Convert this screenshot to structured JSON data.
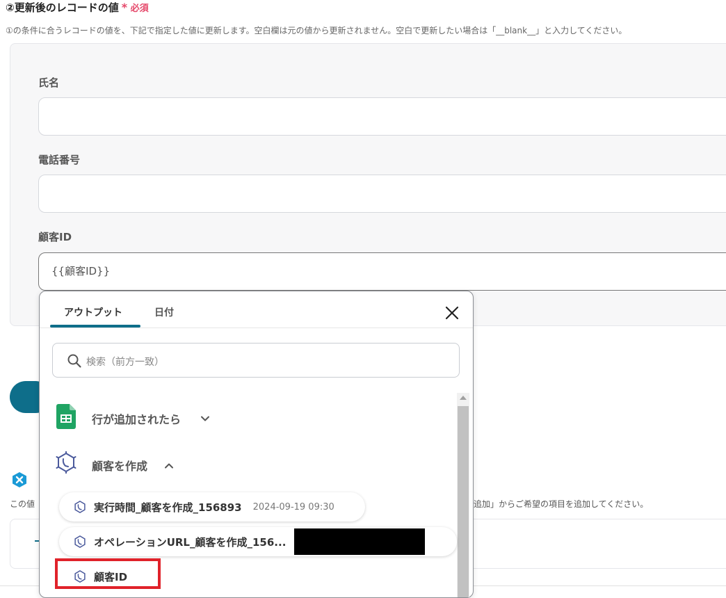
{
  "section": {
    "title": "②更新後のレコードの値",
    "required_mark": "*",
    "required_label": "必須",
    "description": "①の条件に合うレコードの値を、下記で指定した値に更新します。空白欄は元の値から更新されません。空白で更新したい場合は「__blank__」と入力してください。"
  },
  "fields": [
    {
      "label": "氏名",
      "value": ""
    },
    {
      "label": "電話番号",
      "value": ""
    },
    {
      "label": "顧客ID",
      "value": "{{顧客ID}}"
    }
  ],
  "background": {
    "desc_left": "この値",
    "desc_right": "追加」からご希望の項目を追加してください。"
  },
  "popup": {
    "tabs": [
      {
        "label": "アウトプット",
        "active": true
      },
      {
        "label": "日付",
        "active": false
      }
    ],
    "search_placeholder": "検索（前方一致）",
    "groups": [
      {
        "title": "行が追加されたら",
        "icon": "google-sheets-icon",
        "expanded": false
      },
      {
        "title": "顧客を作成",
        "icon": "crm-hexagon-icon",
        "expanded": true
      }
    ],
    "items": [
      {
        "name": "実行時間_顧客を作成_156893",
        "value": "2024-09-19 09:30"
      },
      {
        "name": "オペレーションURL_顧客を作成_156...",
        "value": ""
      },
      {
        "name": "顧客ID",
        "value": ""
      }
    ]
  },
  "colors": {
    "accent": "#0e6e8a",
    "required": "#e5486a",
    "highlight": "#e0222a",
    "sheets_green": "#1fa463"
  }
}
